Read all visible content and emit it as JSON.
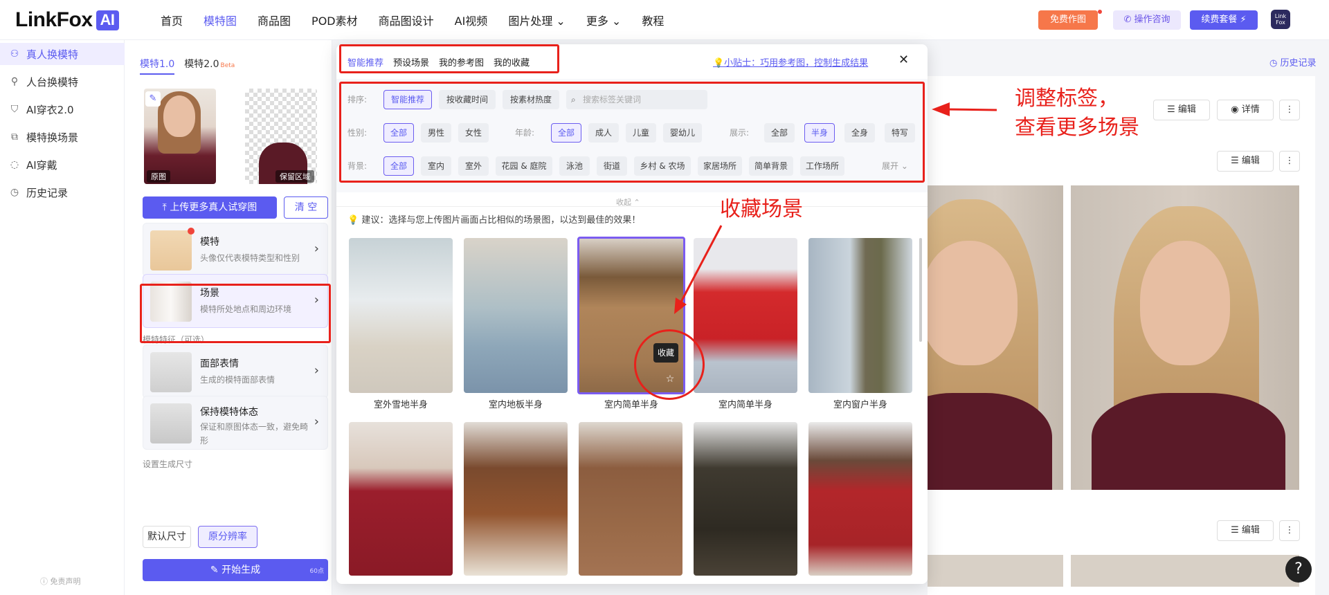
{
  "header": {
    "logo_text": "LinkFox",
    "logo_ai": "AI",
    "nav": [
      "首页",
      "模特图",
      "商品图",
      "POD素材",
      "商品图设计",
      "AI视频",
      "图片处理 ⌄",
      "更多 ⌄",
      "教程"
    ],
    "free_btn": "免费作图",
    "consult_btn": "操作咨询",
    "renew_btn": "续费套餐 ⚡",
    "avatar_text": "Link Fox"
  },
  "sidebar": {
    "items": [
      {
        "label": "真人换模特",
        "icon": "model-swap-icon",
        "glyph": "⚇"
      },
      {
        "label": "人台换模特",
        "icon": "mannequin-icon",
        "glyph": "⚲"
      },
      {
        "label": "AI穿衣2.0",
        "icon": "tshirt-icon",
        "glyph": "⛉"
      },
      {
        "label": "模特换场景",
        "icon": "scene-icon",
        "glyph": "⧉"
      },
      {
        "label": "AI穿戴",
        "icon": "accessory-icon",
        "glyph": "◌"
      },
      {
        "label": "历史记录",
        "icon": "history-icon",
        "glyph": "◷"
      }
    ],
    "disclaimer": "ⓘ 免责声明"
  },
  "panel": {
    "tab1": "模特1.0",
    "tab2": "模特2.0",
    "beta": "Beta",
    "orig_label": "原图",
    "keep_label": "保留区域",
    "upload_btn": "上传更多真人试穿图",
    "clear_btn": "清 空",
    "model_card": {
      "title": "模特",
      "sub": "头像仅代表模特类型和性别"
    },
    "scene_card": {
      "title": "场景",
      "sub": "模特所处地点和周边环境"
    },
    "features_label": "模特特征（可选）",
    "face_card": {
      "title": "面部表情",
      "sub": "生成的模特面部表情"
    },
    "pose_card": {
      "title": "保持模特体态",
      "sub": "保证和原图体态一致，避免畸形"
    },
    "size_label": "设置生成尺寸",
    "size_default": "默认尺寸",
    "size_orig": "原分辨率",
    "generate_btn": "开始生成",
    "generate_badge": "60点"
  },
  "modal": {
    "tabs": [
      "智能推荐",
      "预设场景",
      "我的参考图",
      "我的收藏"
    ],
    "tip": "💡小贴士：巧用参考图，控制生成结果",
    "sort_label": "排序:",
    "sort_opts": [
      "智能推荐",
      "按收藏时间",
      "按素材热度"
    ],
    "search_placeholder": "搜索标签关键词",
    "gender_label": "性别:",
    "gender_opts": [
      "全部",
      "男性",
      "女性"
    ],
    "age_label": "年龄:",
    "age_opts": [
      "全部",
      "成人",
      "儿童",
      "婴幼儿"
    ],
    "show_label": "展示:",
    "show_opts": [
      "全部",
      "半身",
      "全身",
      "特写"
    ],
    "bg_label": "背景:",
    "bg_opts": [
      "全部",
      "室内",
      "室外",
      "花园 & 庭院",
      "泳池",
      "街道",
      "乡村 & 农场",
      "家居场所",
      "简单背景",
      "工作场所"
    ],
    "expand": "展开 ⌄",
    "collapse": "收起 ⌃",
    "suggestion": "💡 建议：选择与您上传图片画面占比相似的场景图，以达到最佳的效果！",
    "row1_caps": [
      "室外雪地半身",
      "室内地板半身",
      "室内简单半身",
      "室内简单半身",
      "室内窗户半身"
    ],
    "fav_tooltip": "收藏"
  },
  "right": {
    "history": "◷ 历史记录",
    "edit": "编辑",
    "detail": "详情",
    "more": "⋮"
  },
  "annotations": {
    "adjust": "调整标签，\n查看更多场景",
    "collect": "收藏场景"
  },
  "help": "?",
  "colors": {
    "accent": "#5b5bf0",
    "annotation": "#e8211b",
    "orange": "#f6774a"
  }
}
